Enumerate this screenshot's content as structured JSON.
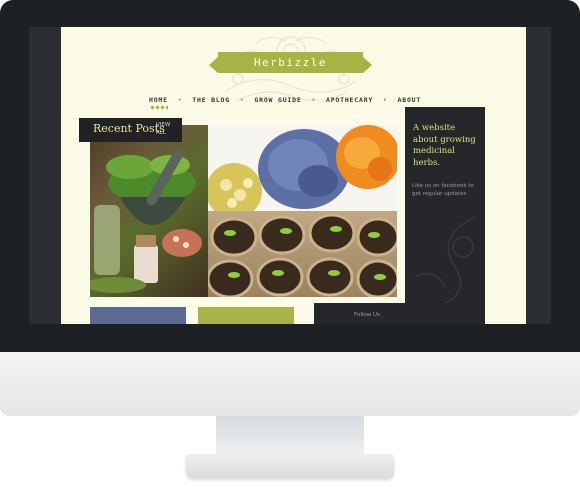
{
  "site": {
    "logo_text": "Herbizzle",
    "nav": [
      "HOME",
      "THE BLOG",
      "GROW GUIDE",
      "APOTHECARY",
      "ABOUT"
    ],
    "recent_posts": {
      "title": "Recent Posts",
      "view_all_line1": "VIEW",
      "view_all_line2": "ALL"
    },
    "sidebar": {
      "headline": "A website about growing medicinal herbs.",
      "blurb": "Like us on facebook to get regular updates",
      "follow": "Follow Us"
    }
  },
  "colors": {
    "accent_green": "#a7b443",
    "dark_panel": "#25272a",
    "headline_yellow": "#dfe07c",
    "page_bg": "#fbfbe8"
  }
}
